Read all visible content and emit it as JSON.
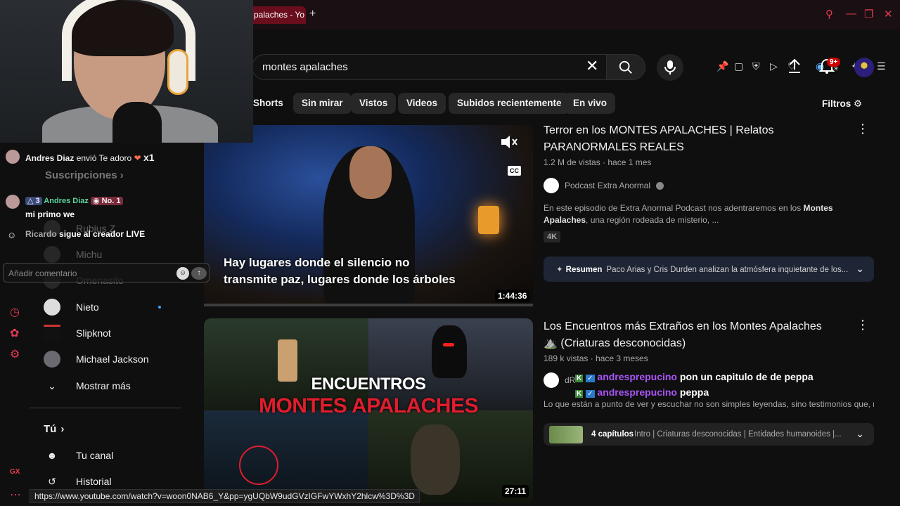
{
  "browser": {
    "tab_title": "palaches - Yo",
    "new_tab": "+",
    "ext_ai": "AI"
  },
  "search": {
    "query": "montes apalaches"
  },
  "notifications": {
    "badge": "9+"
  },
  "chips": [
    "Shorts",
    "Sin mirar",
    "Vistos",
    "Videos",
    "Subidos recientemente",
    "En vivo"
  ],
  "filters": "Filtros",
  "videos": [
    {
      "title": "Terror en los MONTES APALACHES | Relatos PARANORMALES REALES",
      "meta": "1.2 M de vistas · hace 1 mes",
      "channel": "Podcast Extra Anormal",
      "desc_pre": "En este episodio de Extra Anormal Podcast nos adentraremos en los ",
      "desc_bold": "Montes Apalaches",
      "desc_post": ", una región rodeada de misterio, ...",
      "badge": "4K",
      "summary_label": "Resumen",
      "summary_text": "Paco Arias y Cris Durden analizan la atmósfera inquietante de los...",
      "caption": "Hay lugares donde el silencio no transmite paz, lugares donde los árboles",
      "cc": "CC",
      "duration": "1:44:36"
    },
    {
      "title": "Los Encuentros más Extraños en los Montes Apalaches ⛰️ (Criaturas desconocidas)",
      "meta": "189 k vistas · hace 3 meses",
      "channel": "dR",
      "desc": "Lo que están a punto de ver y escuchar no son simples leyendas, sino testimonios que, reale...",
      "chapters_count": "4 capítulos",
      "chapters_text": "Intro | Criaturas desconocidas | Entidades humanoides |...",
      "overlay_line1": "ENCUENTROS",
      "overlay_line2": "MONTES APALACHES",
      "duration": "27:11"
    }
  ],
  "sidebar": {
    "subscriptions": "Suscripciones",
    "subs": [
      "Rubius Z",
      "Michu",
      "Omenasito",
      "Nieto",
      "Slipknot",
      "Michael Jackson"
    ],
    "show_more": "Mostrar más",
    "you": "Tú",
    "your_channel": "Tu canal",
    "history": "Historial"
  },
  "chat": {
    "gift_user": "Andres Diaz",
    "gift_text": "envió Te adoro",
    "gift_count": "x1",
    "level": "3",
    "msg_user": "Andres Diaz",
    "msg_badge": "No. 1",
    "msg_text": "mi primo we",
    "follow_user": "Ricardo",
    "follow_text": "sigue al creador LIVE",
    "input_placeholder": "Añadir comentario"
  },
  "overlay_chat": [
    {
      "user": "andresprepucino",
      "text": "pon un capitulo de de peppa"
    },
    {
      "user": "andresprepucino",
      "text": "peppa"
    }
  ],
  "status_url": "https://www.youtube.com/watch?v=woon0NAB6_Y&pp=ygUQbW9udGVzIGFwYWxhY2hlcw%3D%3D",
  "colors": {
    "accent": "#e33b55",
    "chat_user": "#a855f7",
    "chat_green": "#5bd6a0"
  }
}
